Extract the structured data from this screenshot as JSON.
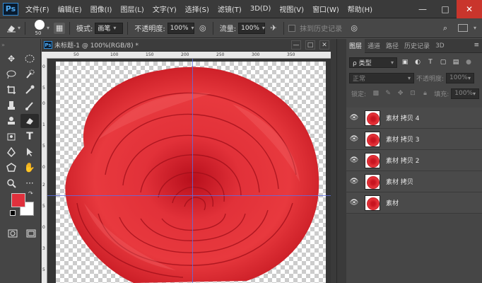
{
  "app": {
    "logo": "Ps"
  },
  "menu": [
    "文件(F)",
    "编辑(E)",
    "图像(I)",
    "图层(L)",
    "文字(Y)",
    "选择(S)",
    "滤镜(T)",
    "3D(D)",
    "视图(V)",
    "窗口(W)",
    "帮助(H)"
  ],
  "window_controls": {
    "minimize": "—",
    "maximize": "□",
    "close": "✕"
  },
  "options": {
    "brush_size": "50",
    "mode_label": "模式:",
    "mode_value": "画笔",
    "opacity_label": "不透明度:",
    "opacity_value": "100%",
    "flow_label": "流量:",
    "flow_value": "100%",
    "erase_history_label": "抹到历史记录"
  },
  "document": {
    "title": "未标题-1 @ 100%(RGB/8) *",
    "ruler_top": [
      "50",
      "100",
      "150",
      "200",
      "250",
      "300",
      "350"
    ],
    "ruler_left": [
      "0",
      "5",
      "0",
      "1",
      "5",
      "0",
      "2",
      "5",
      "0",
      "3",
      "5"
    ]
  },
  "colors": {
    "foreground": "#e0303c",
    "background": "#ffffff",
    "guide": "#5b6fe8"
  },
  "layers_panel": {
    "tabs": [
      "图层",
      "通道",
      "路径",
      "历史记录",
      "3D"
    ],
    "kind_label": "ρ 类型",
    "blend_mode": "正常",
    "opacity_label": "不透明度:",
    "opacity_value": "100%",
    "lock_label": "锁定:",
    "fill_label": "填充:",
    "fill_value": "100%",
    "layers": [
      {
        "name": "素材 拷贝 4"
      },
      {
        "name": "素材 拷贝 3"
      },
      {
        "name": "素材 拷贝 2"
      },
      {
        "name": "素材 拷贝"
      },
      {
        "name": "素材"
      }
    ]
  }
}
